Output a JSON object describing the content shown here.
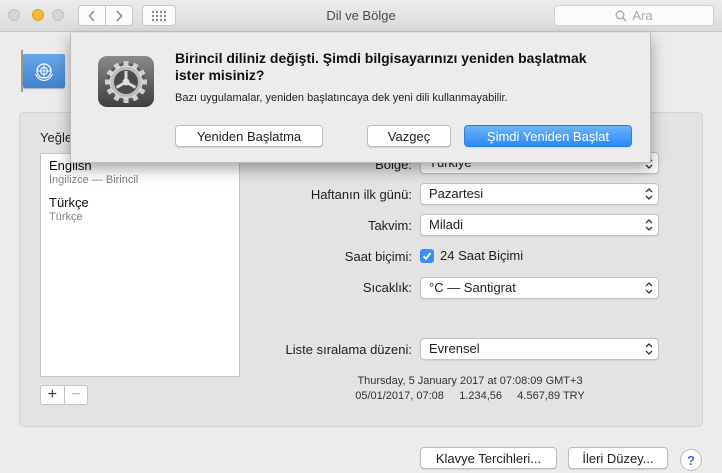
{
  "window": {
    "title": "Dil ve Bölge"
  },
  "toolbar": {
    "search_placeholder": "Ara"
  },
  "languages": {
    "label": "Yeğlenen diller:",
    "items": [
      {
        "name": "English",
        "subtitle": "İngilizce — Birincil"
      },
      {
        "name": "Türkçe",
        "subtitle": "Türkçe"
      }
    ],
    "add_label": "+",
    "remove_label": "−"
  },
  "settings": {
    "region": {
      "label": "Bölge:",
      "value": "Türkiye"
    },
    "first_day": {
      "label": "Haftanın ilk günü:",
      "value": "Pazartesi"
    },
    "calendar": {
      "label": "Takvim:",
      "value": "Miladi"
    },
    "time_format": {
      "label": "Saat biçimi:",
      "checkbox_label": "24 Saat Biçimi",
      "checked": true
    },
    "temperature": {
      "label": "Sıcaklık:",
      "value": "°C — Santigrat"
    },
    "sort_order": {
      "label": "Liste sıralama düzeni:",
      "value": "Evrensel"
    }
  },
  "sample": {
    "line1": "Thursday, 5 January 2017 at 07:08:09 GMT+3",
    "line2": "05/01/2017, 07:08     1.234,56     4.567,89 TRY"
  },
  "footer": {
    "keyboard_button": "Klavye Tercihleri...",
    "advanced_button": "İleri Düzey...",
    "help_label": "?"
  },
  "dialog": {
    "title": "Birincil diliniz değişti. Şimdi bilgisayarınızı yeniden başlatmak ister misiniz?",
    "message": "Bazı uygulamalar, yeniden başlatıncaya dek yeni dili kullanmayabilir.",
    "buttons": {
      "dont_restart": "Yeniden Başlatma",
      "cancel": "Vazgeç",
      "restart_now": "Şimdi Yeniden Başlat"
    }
  },
  "colors": {
    "accent": "#2a8af6",
    "window_bg": "#ececec",
    "checkbox": "#3d8ff5"
  }
}
